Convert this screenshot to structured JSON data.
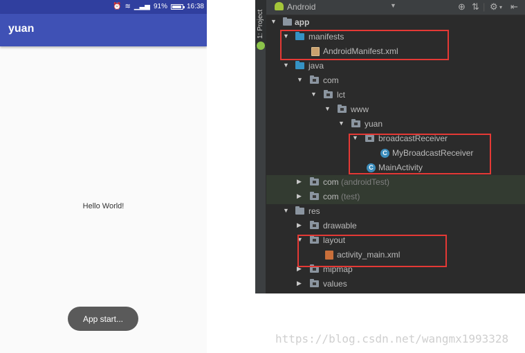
{
  "phone": {
    "status": {
      "battery_percent": "91%",
      "time": "16:38"
    },
    "app_title": "yuan",
    "hello_text": "Hello World!",
    "toast": "App start..."
  },
  "ide": {
    "side_tab": "1: Project",
    "view_selector": "Android",
    "tree": [
      {
        "label": "app",
        "bold": true
      },
      {
        "label": "manifests"
      },
      {
        "label": "AndroidManifest.xml"
      },
      {
        "label": "java"
      },
      {
        "label": "com"
      },
      {
        "label": "lct"
      },
      {
        "label": "www"
      },
      {
        "label": "yuan"
      },
      {
        "label": "broadcastReceiver"
      },
      {
        "label": "MyBroadcastReceiver"
      },
      {
        "label": "MainActivity"
      },
      {
        "label": "com",
        "suffix": "(androidTest)"
      },
      {
        "label": "com",
        "suffix": "(test)"
      },
      {
        "label": "res"
      },
      {
        "label": "drawable"
      },
      {
        "label": "layout"
      },
      {
        "label": "activity_main.xml"
      },
      {
        "label": "mipmap"
      },
      {
        "label": "values"
      }
    ],
    "colors": {
      "background": "#2B2B2B",
      "highlight_box": "#E53935",
      "class_icon": "#3C8DBC"
    }
  },
  "watermark": "https://blog.csdn.net/wangmx1993328"
}
